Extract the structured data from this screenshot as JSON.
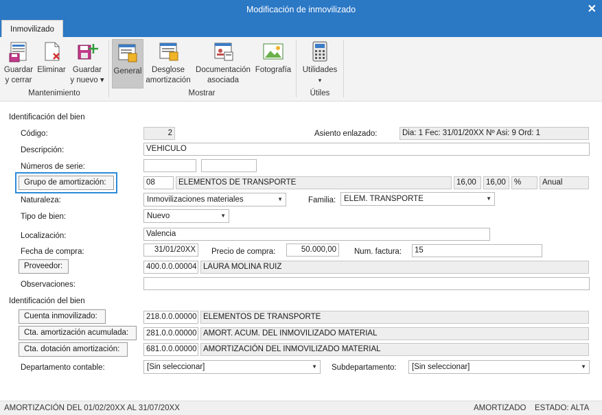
{
  "window": {
    "title": "Modificación de inmovilizado"
  },
  "tabs": [
    {
      "label": "Inmovilizado"
    }
  ],
  "ribbon": {
    "groups": {
      "mantenimiento": "Mantenimiento",
      "mostrar": "Mostrar",
      "utiles": "Útiles"
    },
    "buttons": {
      "guardar_cerrar": [
        "Guardar",
        "y cerrar"
      ],
      "eliminar": [
        "Eliminar"
      ],
      "guardar_nuevo": [
        "Guardar",
        "y nuevo ▾"
      ],
      "general": [
        "General"
      ],
      "desglose": [
        "Desglose",
        "amortización"
      ],
      "documentacion": [
        "Documentación",
        "asociada"
      ],
      "fotografia": [
        "Fotografía"
      ],
      "utilidades": [
        "Utilidades",
        "▾"
      ]
    }
  },
  "sections": {
    "identificacion_1": "Identificación del bien",
    "identificacion_2": "Identificación del bien"
  },
  "form": {
    "codigo_label": "Código:",
    "codigo": "2",
    "asiento_label": "Asiento enlazado:",
    "asiento": "Dia: 1 Fec: 31/01/20XX Nº Asi: 9 Ord: 1",
    "descripcion_label": "Descripción:",
    "descripcion": "VEHICULO",
    "numeros_serie_label": "Números de serie:",
    "serie_1": "",
    "serie_2": "",
    "grupo_button": "Grupo de amortización:",
    "grupo_codigo": "08",
    "grupo_nombre": "ELEMENTOS DE TRANSPORTE",
    "grupo_pct_1": "16,00",
    "grupo_pct_2": "16,00",
    "grupo_pct_symbol": "%",
    "grupo_periodo": "Anual",
    "naturaleza_label": "Naturaleza:",
    "naturaleza": "Inmovilizaciones materiales",
    "familia_label": "Familia:",
    "familia": "ELEM. TRANSPORTE",
    "tipo_label": "Tipo de bien:",
    "tipo": "Nuevo",
    "localizacion_label": "Localización:",
    "localizacion": "Valencia",
    "fecha_label": "Fecha de compra:",
    "fecha": "31/01/20XX",
    "precio_label": "Precio de compra:",
    "precio": "50.000,00",
    "factura_label": "Num. factura:",
    "factura": "15",
    "proveedor_button": "Proveedor:",
    "proveedor_codigo": "400.0.0.00004",
    "proveedor_nombre": "LAURA MOLINA RUIZ",
    "observaciones_label": "Observaciones:",
    "observaciones": "",
    "cuenta_inm_button": "Cuenta inmovilizado:",
    "cuenta_inm_codigo": "218.0.0.00000",
    "cuenta_inm_nombre": "ELEMENTOS DE TRANSPORTE",
    "cta_amort_acum_button": "Cta. amortización acumulada:",
    "cta_amort_acum_codigo": "281.0.0.00000",
    "cta_amort_acum_nombre": "AMORT. ACUM. DEL INMOVILIZADO MATERIAL",
    "cta_dotacion_button": "Cta. dotación amortización:",
    "cta_dotacion_codigo": "681.0.0.00000",
    "cta_dotacion_nombre": "AMORTIZACIÓN DEL INMOVILIZADO MATERIAL",
    "departamento_label": "Departamento contable:",
    "departamento": "[Sin seleccionar]",
    "subdepartamento_label": "Subdepartamento:",
    "subdepartamento": "[Sin seleccionar]"
  },
  "status": {
    "periodo": "AMORTIZACIÓN DEL 01/02/20XX AL 31/07/20XX",
    "amortizado": "AMORTIZADO",
    "estado": "ESTADO: ALTA"
  },
  "colors": {
    "accent": "#2b78c5",
    "focus": "#2b8ad8"
  }
}
